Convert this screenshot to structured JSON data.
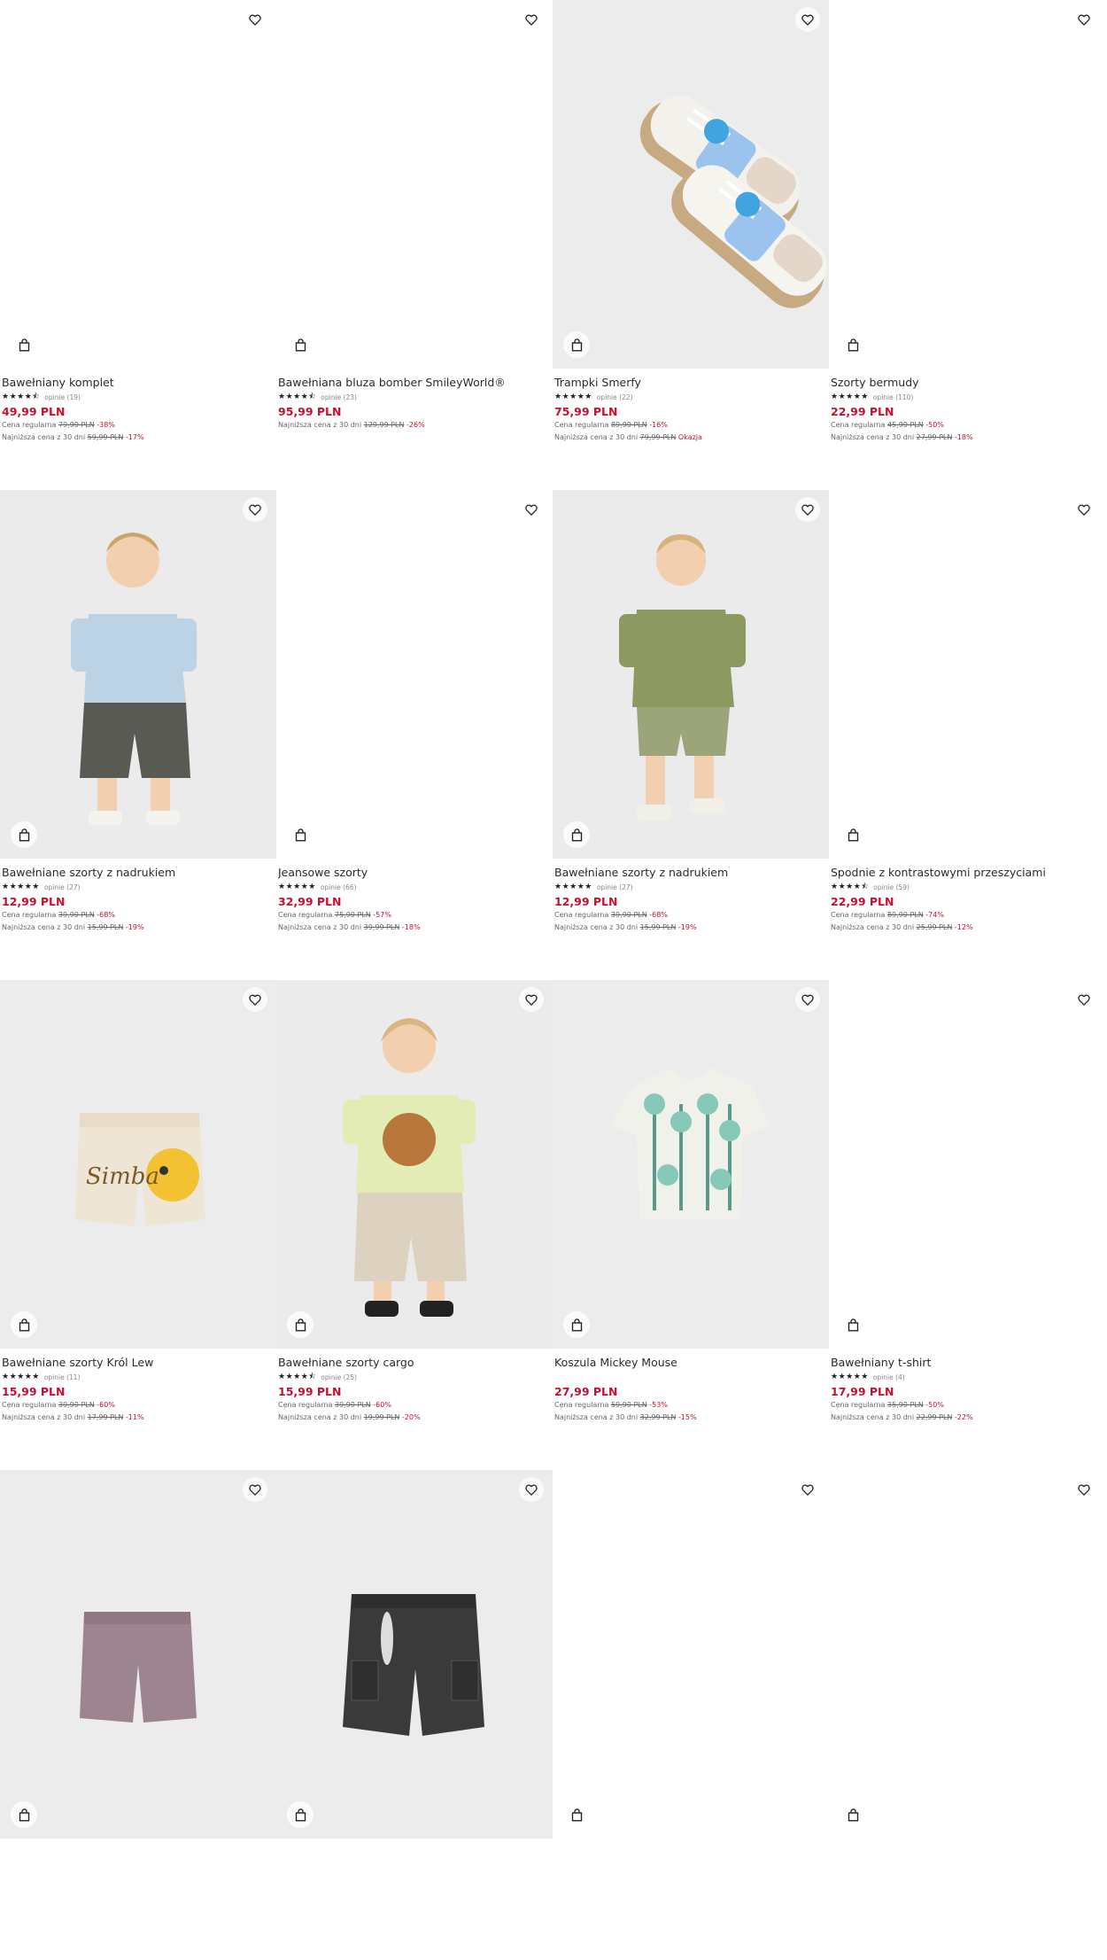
{
  "products": [
    {
      "name": "Bawełniany komplet",
      "rating": "★★★★⯪",
      "opinions": "opinie (19)",
      "price": "49,99 PLN",
      "regular_label": "Cena regularna",
      "regular_price": "79,99 PLN",
      "regular_discount": "-38%",
      "lowest_label": "Najniższa cena z 30 dni",
      "lowest_price": "59,99 PLN",
      "lowest_discount": "-17%",
      "photo": "none"
    },
    {
      "name": "Bawełniana bluza bomber SmileyWorld®",
      "rating": "★★★★⯪",
      "opinions": "opinie (23)",
      "price": "95,99 PLN",
      "regular_label": "",
      "regular_price": "",
      "regular_discount": "",
      "lowest_label": "Najniższa cena z 30 dni",
      "lowest_price": "129,99 PLN",
      "lowest_discount": "-26%",
      "photo": "none"
    },
    {
      "name": "Trampki Smerfy",
      "rating": "★★★★★",
      "opinions": "opinie (22)",
      "price": "75,99 PLN",
      "regular_label": "Cena regularna",
      "regular_price": "89,99 PLN",
      "regular_discount": "-16%",
      "lowest_label": "Najniższa cena z 30 dni",
      "lowest_price": "79,99 PLN",
      "lowest_discount": "Okazja",
      "photo": "sneakers"
    },
    {
      "name": "Szorty bermudy",
      "rating": "★★★★★",
      "opinions": "opinie (110)",
      "price": "22,99 PLN",
      "regular_label": "Cena regularna",
      "regular_price": "45,99 PLN",
      "regular_discount": "-50%",
      "lowest_label": "Najniższa cena z 30 dni",
      "lowest_price": "27,99 PLN",
      "lowest_discount": "-18%",
      "photo": "none"
    },
    {
      "name": "Bawełniane szorty z nadrukiem",
      "rating": "★★★★★",
      "opinions": "opinie (27)",
      "price": "12,99 PLN",
      "regular_label": "Cena regularna",
      "regular_price": "39,99 PLN",
      "regular_discount": "-68%",
      "lowest_label": "Najniższa cena z 30 dni",
      "lowest_price": "15,99 PLN",
      "lowest_discount": "-19%",
      "photo": "kid-blue"
    },
    {
      "name": "Jeansowe szorty",
      "rating": "★★★★★",
      "opinions": "opinie (66)",
      "price": "32,99 PLN",
      "regular_label": "Cena regularna",
      "regular_price": "75,99 PLN",
      "regular_discount": "-57%",
      "lowest_label": "Najniższa cena z 30 dni",
      "lowest_price": "39,99 PLN",
      "lowest_discount": "-18%",
      "photo": "none"
    },
    {
      "name": "Bawełniane szorty z nadrukiem",
      "rating": "★★★★★",
      "opinions": "opinie (27)",
      "price": "12,99 PLN",
      "regular_label": "Cena regularna",
      "regular_price": "39,99 PLN",
      "regular_discount": "-68%",
      "lowest_label": "Najniższa cena z 30 dni",
      "lowest_price": "15,99 PLN",
      "lowest_discount": "-19%",
      "photo": "kid-green"
    },
    {
      "name": "Spodnie z kontrastowymi przeszyciami",
      "rating": "★★★★⯪",
      "opinions": "opinie (59)",
      "price": "22,99 PLN",
      "regular_label": "Cena regularna",
      "regular_price": "89,99 PLN",
      "regular_discount": "-74%",
      "lowest_label": "Najniższa cena z 30 dni",
      "lowest_price": "25,99 PLN",
      "lowest_discount": "-12%",
      "photo": "none"
    },
    {
      "name": "Bawełniane szorty Król Lew",
      "rating": "★★★★★",
      "opinions": "opinie (11)",
      "price": "15,99 PLN",
      "regular_label": "Cena regularna",
      "regular_price": "39,99 PLN",
      "regular_discount": "-60%",
      "lowest_label": "Najniższa cena z 30 dni",
      "lowest_price": "17,99 PLN",
      "lowest_discount": "-11%",
      "photo": "simba-shorts"
    },
    {
      "name": "Bawełniane szorty cargo",
      "rating": "★★★★⯪",
      "opinions": "opinie (25)",
      "price": "15,99 PLN",
      "regular_label": "Cena regularna",
      "regular_price": "39,99 PLN",
      "regular_discount": "-60%",
      "lowest_label": "Najniższa cena z 30 dni",
      "lowest_price": "19,99 PLN",
      "lowest_discount": "-20%",
      "photo": "kid-cargo"
    },
    {
      "name": "Koszula Mickey Mouse",
      "rating": "",
      "opinions": "",
      "price": "27,99 PLN",
      "regular_label": "Cena regularna",
      "regular_price": "59,99 PLN",
      "regular_discount": "-53%",
      "lowest_label": "Najniższa cena z 30 dni",
      "lowest_price": "32,99 PLN",
      "lowest_discount": "-15%",
      "photo": "shirt"
    },
    {
      "name": "Bawełniany t-shirt",
      "rating": "★★★★★",
      "opinions": "opinie (4)",
      "price": "17,99 PLN",
      "regular_label": "Cena regularna",
      "regular_price": "35,99 PLN",
      "regular_discount": "-50%",
      "lowest_label": "Najniższa cena z 30 dni",
      "lowest_price": "22,99 PLN",
      "lowest_discount": "-22%",
      "photo": "none"
    },
    {
      "name": "",
      "rating": "",
      "opinions": "",
      "price": "",
      "regular_label": "",
      "regular_price": "",
      "regular_discount": "",
      "lowest_label": "",
      "lowest_price": "",
      "lowest_discount": "",
      "photo": "purple-shorts"
    },
    {
      "name": "",
      "rating": "",
      "opinions": "",
      "price": "",
      "regular_label": "",
      "regular_price": "",
      "regular_discount": "",
      "lowest_label": "",
      "lowest_price": "",
      "lowest_discount": "",
      "photo": "denim-shorts"
    },
    {
      "name": "",
      "rating": "",
      "opinions": "",
      "price": "",
      "regular_label": "",
      "regular_price": "",
      "regular_discount": "",
      "lowest_label": "",
      "lowest_price": "",
      "lowest_discount": "",
      "photo": "none"
    },
    {
      "name": "",
      "rating": "",
      "opinions": "",
      "price": "",
      "regular_label": "",
      "regular_price": "",
      "regular_discount": "",
      "lowest_label": "",
      "lowest_price": "",
      "lowest_discount": "",
      "photo": "none"
    }
  ],
  "colors": {
    "price": "#c8102e",
    "photo_bg": "#ececec"
  },
  "icons": {
    "wishlist": "heart-icon",
    "add_to_cart": "shopping-bag-icon"
  }
}
